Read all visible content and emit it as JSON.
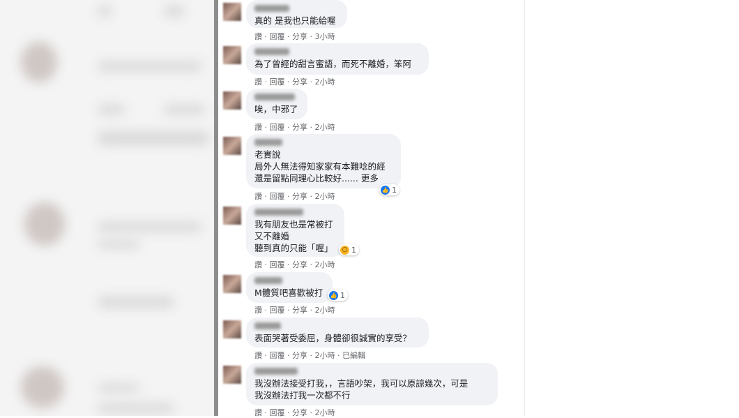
{
  "actions": {
    "like": "讚",
    "reply": "回覆",
    "share": "分享"
  },
  "comments": [
    {
      "text": "真的 是我也只能給喔",
      "time": "3小時"
    },
    {
      "text": "為了曾經的甜言蜜語，而死不離婚，笨阿",
      "time": "2小時"
    },
    {
      "text": "唉，中邪了",
      "time": "2小時"
    },
    {
      "text": "老實說\n局外人無法得知家家有本難唸的經\n還是留點同理心比較好...... 更多",
      "time": "2小時",
      "reaction": {
        "icon": "like-icon",
        "count": "1"
      }
    },
    {
      "text": "我有朋友也是常被打\n又不離婚\n聽到真的只能「喔」",
      "time": "2小時",
      "reaction": {
        "icon": "wow-icon",
        "count": "1"
      }
    },
    {
      "text": "M體質吧喜歡被打",
      "time": "2小時",
      "reaction": {
        "icon": "like-icon",
        "count": "1"
      }
    },
    {
      "text": "表面哭著受委屈，身體卻很誠實的享受？",
      "time": "2小時",
      "edited": "已編輯"
    },
    {
      "text": "我沒辦法接受打我，，言語吵架，我可以原諒幾次，可是\n我沒辦法打我一次都不行",
      "time": "2小時"
    }
  ],
  "colors": {
    "bubble": "#f0f2f5",
    "like": "#1877f2",
    "wow": "#f7b125"
  }
}
